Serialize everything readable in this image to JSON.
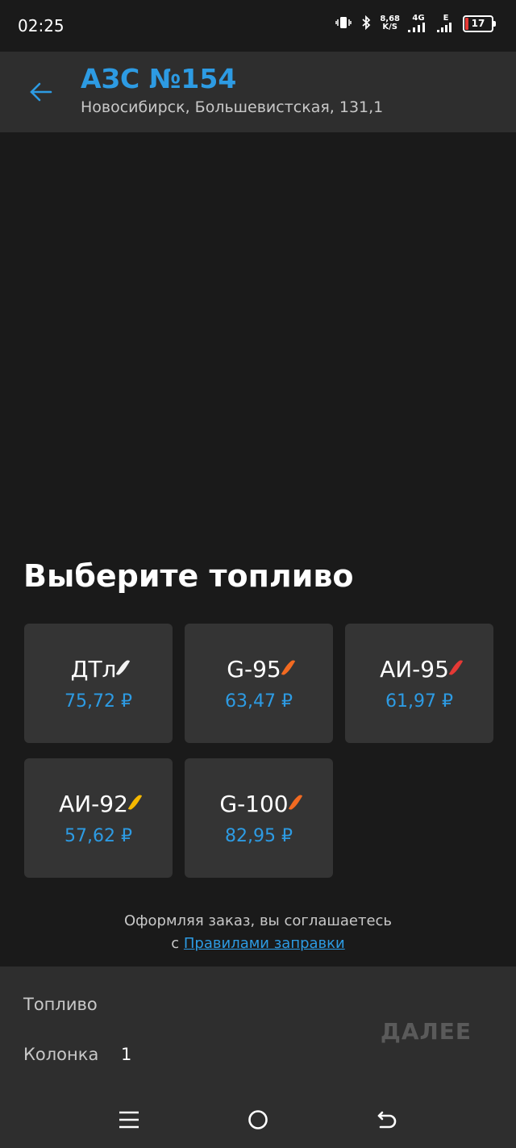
{
  "status": {
    "time": "02:25",
    "net_speed_value": "8,68",
    "net_speed_unit": "K/S",
    "network": "4G",
    "network2": "E",
    "battery": "17"
  },
  "header": {
    "title": "АЗС №154",
    "address": "Новосибирск, Большевистская, 131,1"
  },
  "section_title": "Выберите топливо",
  "fuels": [
    {
      "name": "ДТл",
      "price": "75,72 ₽",
      "drop_color": "#f2f2f2"
    },
    {
      "name": "G-95",
      "price": "63,47 ₽",
      "drop_color": "#f26a21"
    },
    {
      "name": "АИ-95",
      "price": "61,97 ₽",
      "drop_color": "#e53935"
    },
    {
      "name": "АИ-92",
      "price": "57,62 ₽",
      "drop_color": "#f5b800"
    },
    {
      "name": "G-100",
      "price": "82,95 ₽",
      "drop_color": "#f26a21"
    }
  ],
  "agreement": {
    "text": "Оформляя заказ, вы соглашаетесь",
    "prefix": "с ",
    "link": "Правилами заправки"
  },
  "summary": {
    "fuel_label": "Топливо",
    "fuel_value": "",
    "pump_label": "Колонка",
    "pump_value": "1",
    "next_label": "ДАЛЕЕ"
  },
  "colors": {
    "accent": "#2d9be3",
    "background": "#1a1a1a",
    "panel": "#2e2e2e",
    "tile": "#343434"
  }
}
